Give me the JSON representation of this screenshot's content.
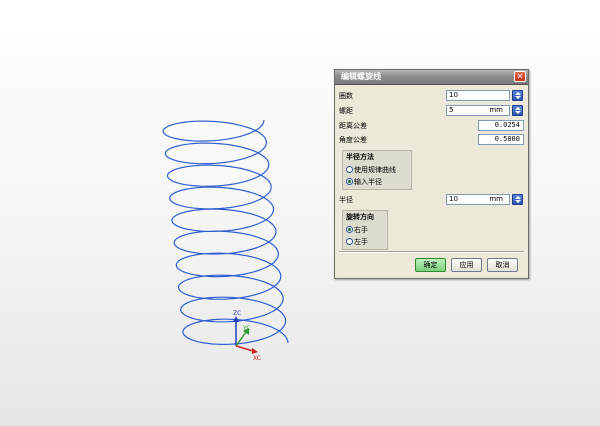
{
  "dialog": {
    "title": "编辑螺旋线",
    "close_symbol": "✕",
    "turns": {
      "label": "圈数",
      "value": "10"
    },
    "pitch": {
      "label": "螺距",
      "value": "5",
      "unit": "mm"
    },
    "distance_tolerance": {
      "label": "距离公差",
      "value": "0.0254"
    },
    "angle_tolerance": {
      "label": "角度公差",
      "value": "0.5000"
    },
    "radius_method": {
      "title": "半径方法",
      "options": [
        {
          "label": "使用规律曲线",
          "selected": false
        },
        {
          "label": "输入半径",
          "selected": true
        }
      ]
    },
    "radius": {
      "label": "半径",
      "value": "10",
      "unit": "mm"
    },
    "rotation_direction": {
      "title": "旋转方向",
      "options": [
        {
          "label": "右手",
          "selected": true
        },
        {
          "label": "左手",
          "selected": false
        }
      ]
    },
    "buttons": {
      "ok": "确定",
      "apply": "应用",
      "cancel": "取消"
    }
  },
  "viewport": {
    "axes": {
      "z": "ZC",
      "y": "YC",
      "x": "XC"
    },
    "helix_turns": 10,
    "colors": {
      "helix": "#2f5fcf",
      "axis_z": "#1f3fbf",
      "axis_y": "#2e9a2e",
      "axis_x": "#cc2222"
    }
  }
}
